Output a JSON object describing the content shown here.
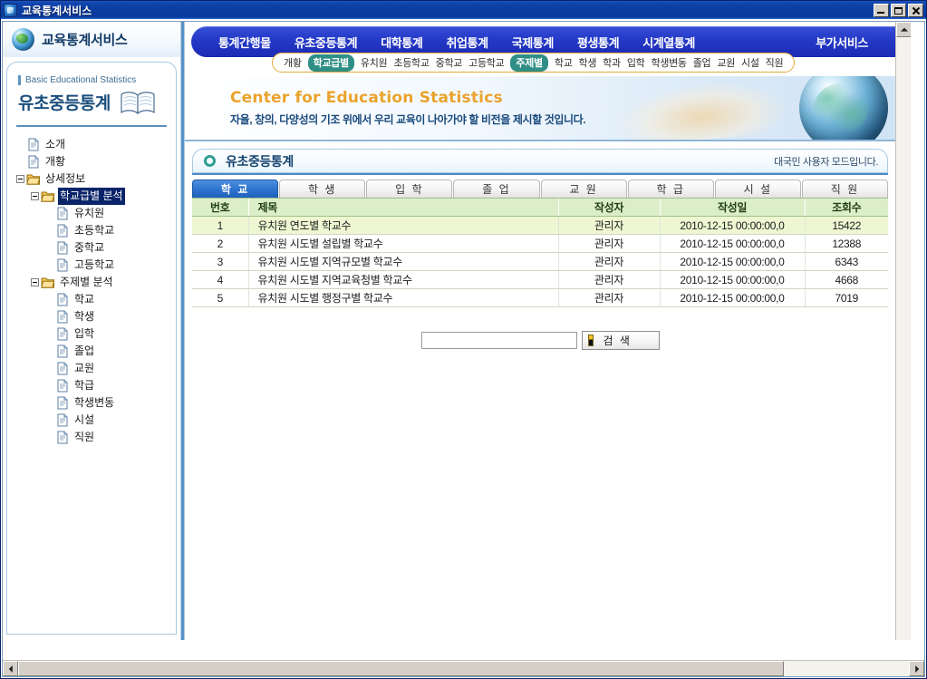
{
  "window": {
    "title": "교육통계서비스",
    "icon": "app-globe-icon",
    "minimize": "_",
    "maximize": "□",
    "close": "×"
  },
  "brand": {
    "logo_icon": "globe-icon",
    "name": "교육통계서비스"
  },
  "topnav": {
    "items": [
      {
        "label": "통계간행물"
      },
      {
        "label": "유초중등통계"
      },
      {
        "label": "대학통계"
      },
      {
        "label": "취업통계"
      },
      {
        "label": "국제통계"
      },
      {
        "label": "평생통계"
      },
      {
        "label": "시계열통계"
      }
    ],
    "extra": {
      "label": "부가서비스"
    }
  },
  "subnav": {
    "items": [
      {
        "label": "개황",
        "pill": false
      },
      {
        "label": "학교급별",
        "pill": true
      },
      {
        "label": "유치원",
        "pill": false
      },
      {
        "label": "초등학교",
        "pill": false
      },
      {
        "label": "중학교",
        "pill": false
      },
      {
        "label": "고등학교",
        "pill": false
      },
      {
        "label": "주제별",
        "pill": true
      },
      {
        "label": "학교",
        "pill": false
      },
      {
        "label": "학생",
        "pill": false
      },
      {
        "label": "학과",
        "pill": false
      },
      {
        "label": "입학",
        "pill": false
      },
      {
        "label": "학생변동",
        "pill": false
      },
      {
        "label": "졸업",
        "pill": false
      },
      {
        "label": "교원",
        "pill": false
      },
      {
        "label": "시설",
        "pill": false
      },
      {
        "label": "직원",
        "pill": false
      }
    ]
  },
  "hero": {
    "english": "Center for Education Statistics",
    "korean": "자율, 창의, 다양성의 기조 위에서 우리 교육이 나아가야 할 비전을 제시할 것입니다."
  },
  "sidebar": {
    "eyebrow": "Basic Educational Statistics",
    "title": "유초중등통계",
    "book_icon": "open-book-icon",
    "tree": [
      {
        "label": "소개",
        "level": 1,
        "icon": "page-icon",
        "toggle": "none",
        "selected": false
      },
      {
        "label": "개황",
        "level": 1,
        "icon": "page-icon",
        "toggle": "none",
        "selected": false
      },
      {
        "label": "상세정보",
        "level": 1,
        "icon": "folder-icon",
        "toggle": "minus",
        "selected": false
      },
      {
        "label": "학교급별 분석",
        "level": 2,
        "icon": "folder-icon",
        "toggle": "minus",
        "selected": true
      },
      {
        "label": "유치원",
        "level": 3,
        "icon": "page-icon",
        "toggle": "none",
        "selected": false
      },
      {
        "label": "초등학교",
        "level": 3,
        "icon": "page-icon",
        "toggle": "none",
        "selected": false
      },
      {
        "label": "중학교",
        "level": 3,
        "icon": "page-icon",
        "toggle": "none",
        "selected": false
      },
      {
        "label": "고등학교",
        "level": 3,
        "icon": "page-icon",
        "toggle": "none",
        "selected": false
      },
      {
        "label": "주제별 분석",
        "level": 2,
        "icon": "folder-icon",
        "toggle": "minus",
        "selected": false
      },
      {
        "label": "학교",
        "level": 3,
        "icon": "page-icon",
        "toggle": "none",
        "selected": false
      },
      {
        "label": "학생",
        "level": 3,
        "icon": "page-icon",
        "toggle": "none",
        "selected": false
      },
      {
        "label": "입학",
        "level": 3,
        "icon": "page-icon",
        "toggle": "none",
        "selected": false
      },
      {
        "label": "졸업",
        "level": 3,
        "icon": "page-icon",
        "toggle": "none",
        "selected": false
      },
      {
        "label": "교원",
        "level": 3,
        "icon": "page-icon",
        "toggle": "none",
        "selected": false
      },
      {
        "label": "학급",
        "level": 3,
        "icon": "page-icon",
        "toggle": "none",
        "selected": false
      },
      {
        "label": "학생변동",
        "level": 3,
        "icon": "page-icon",
        "toggle": "none",
        "selected": false
      },
      {
        "label": "시설",
        "level": 3,
        "icon": "page-icon",
        "toggle": "none",
        "selected": false
      },
      {
        "label": "직원",
        "level": 3,
        "icon": "page-icon",
        "toggle": "none",
        "selected": false
      }
    ]
  },
  "page": {
    "title": "유초중등통계",
    "mode_note": "대국민 사용자 모드입니다."
  },
  "tabs": [
    {
      "label": "학 교",
      "active": true
    },
    {
      "label": "학 생",
      "active": false
    },
    {
      "label": "입 학",
      "active": false
    },
    {
      "label": "졸 업",
      "active": false
    },
    {
      "label": "교 원",
      "active": false
    },
    {
      "label": "학 급",
      "active": false
    },
    {
      "label": "시 설",
      "active": false
    },
    {
      "label": "직 원",
      "active": false
    }
  ],
  "table": {
    "headers": [
      "번호",
      "제목",
      "작성자",
      "작성일",
      "조회수"
    ],
    "rows": [
      {
        "no": "1",
        "title": "유치원 연도별 학교수",
        "writer": "관리자",
        "date": "2010-12-15 00:00:00,0",
        "hits": "15422",
        "highlight": true
      },
      {
        "no": "2",
        "title": "유치원 시도별 설립별 학교수",
        "writer": "관리자",
        "date": "2010-12-15 00:00:00,0",
        "hits": "12388",
        "highlight": false
      },
      {
        "no": "3",
        "title": "유치원 시도별 지역규모별 학교수",
        "writer": "관리자",
        "date": "2010-12-15 00:00:00,0",
        "hits": "6343",
        "highlight": false
      },
      {
        "no": "4",
        "title": "유치원 시도별 지역교육청별 학교수",
        "writer": "관리자",
        "date": "2010-12-15 00:00:00,0",
        "hits": "4668",
        "highlight": false
      },
      {
        "no": "5",
        "title": "유치원 시도별 행정구별 학교수",
        "writer": "관리자",
        "date": "2010-12-15 00:00:00,0",
        "hits": "7019",
        "highlight": false
      }
    ]
  },
  "search": {
    "value": "",
    "placeholder": "",
    "button_label": "검 색",
    "button_icon": "search-marker-icon"
  },
  "colors": {
    "titlebar": "#0a3a9c",
    "navbar": "#2438c6",
    "accent_orange": "#eaa32c",
    "pill_teal": "#2f8f86",
    "tab_active": "#2f74cf",
    "table_header": "#dceec9",
    "row_highlight": "#eef7d2",
    "selection": "#0a246a",
    "divider_blue": "#4f8cc4"
  }
}
